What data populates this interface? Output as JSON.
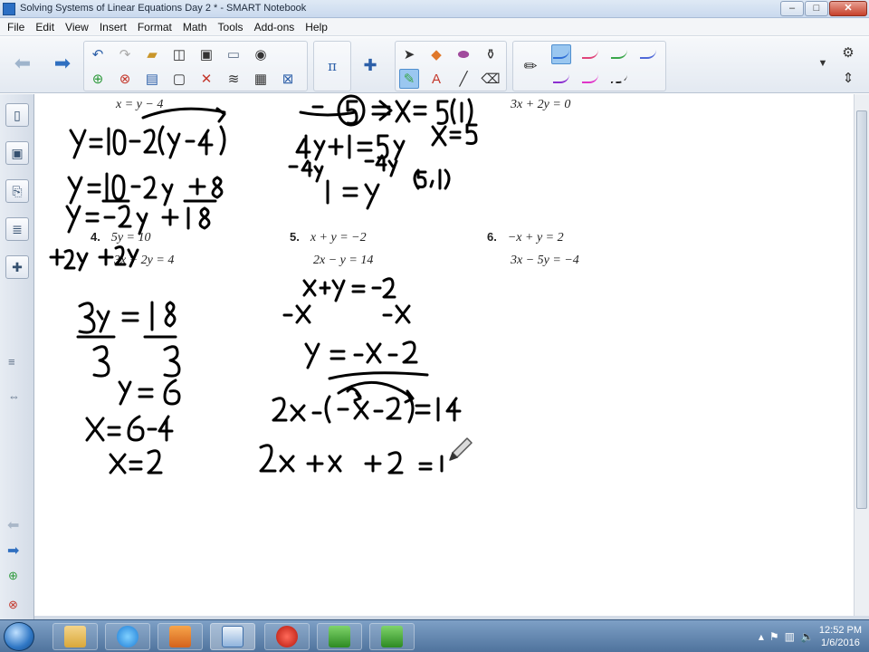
{
  "window": {
    "title": "Solving Systems of Linear Equations Day 2 * - SMART Notebook",
    "minimize": "–",
    "maximize": "□",
    "close": "✕"
  },
  "menu": [
    "File",
    "Edit",
    "View",
    "Insert",
    "Format",
    "Math",
    "Tools",
    "Add-ons",
    "Help"
  ],
  "toolbar": {
    "math_symbol": "π",
    "pen_colors": [
      "#2f6fd6",
      "#e0457a",
      "#3aa64a",
      "#4f69d8",
      "#8b2fd0",
      "#e035c8",
      "#2a2a2a"
    ]
  },
  "canvas": {
    "printed": {
      "p4": {
        "num": "4.",
        "eq1": "5y = 10",
        "eq2": "3x + 2y = 4"
      },
      "p5": {
        "num": "5.",
        "eq1": "x + y = −2",
        "eq2": "2x − y = 14"
      },
      "p6": {
        "num": "6.",
        "eq1": "−x + y = 2",
        "eq2": "3x − 5y = −4"
      },
      "top_left": "x = y − 4",
      "top_right": "3x + 2y = 0"
    }
  },
  "taskbar": {
    "time": "12:52 PM",
    "date": "1/6/2016"
  }
}
